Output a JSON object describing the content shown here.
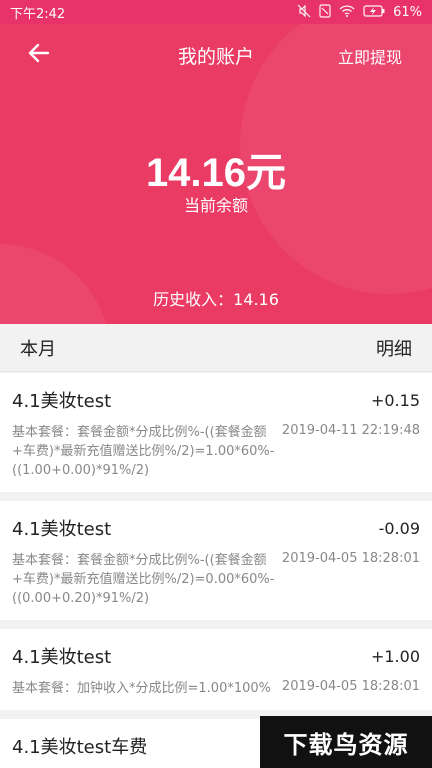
{
  "statusbar": {
    "time": "下午2:42",
    "battery": "61%"
  },
  "header": {
    "title": "我的账户",
    "withdraw_label": "立即提现",
    "balance": "14.16元",
    "balance_label": "当前余额",
    "history_income": "历史收入：14.16"
  },
  "month_bar": {
    "period": "本月",
    "detail_label": "明细"
  },
  "records": [
    {
      "title": "4.1美妆test",
      "amount": "+0.15",
      "desc": "基本套餐：套餐金额*分成比例%-((套餐金额+车费)*最新充值赠送比例%/2)=1.00*60%-((1.00+0.00)*91%/2)",
      "date": "2019-04-11 22:19:48"
    },
    {
      "title": "4.1美妆test",
      "amount": "-0.09",
      "desc": "基本套餐：套餐金额*分成比例%-((套餐金额+车费)*最新充值赠送比例%/2)=0.00*60%-((0.00+0.20)*91%/2)",
      "date": "2019-04-05 18:28:01"
    },
    {
      "title": "4.1美妆test",
      "amount": "+1.00",
      "desc": "基本套餐：加钟收入*分成比例=1.00*100%",
      "date": "2019-04-05 18:28:01"
    },
    {
      "title": "4.1美妆test车费",
      "amount": "",
      "desc": "",
      "date": ""
    }
  ],
  "watermark": "下载鸟资源",
  "colors": {
    "brand": "#ea3b65",
    "statusbar": "#e8336a"
  }
}
